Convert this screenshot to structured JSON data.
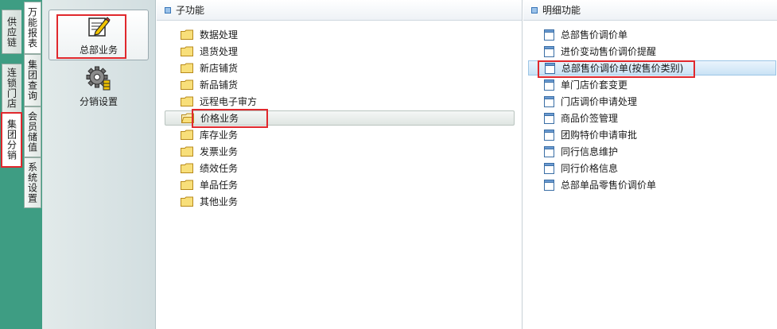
{
  "outer_tabs": [
    {
      "label": "供应链"
    },
    {
      "label": "连锁门店"
    },
    {
      "label": "集团分销",
      "active": true
    }
  ],
  "inner_tabs": [
    {
      "label": "万能报表"
    },
    {
      "label": "集团查询"
    },
    {
      "label": "会员储值"
    },
    {
      "label": "系统设置"
    }
  ],
  "modules": [
    {
      "label": "总部业务",
      "icon": "pen-on-doc-icon",
      "selected": true
    },
    {
      "label": "分销设置",
      "icon": "gear-icon"
    }
  ],
  "sub_panel": {
    "title": "子功能",
    "items": [
      {
        "label": "数据处理"
      },
      {
        "label": "退货处理"
      },
      {
        "label": "新店铺货"
      },
      {
        "label": "新品铺货"
      },
      {
        "label": "远程电子审方"
      },
      {
        "label": "价格业务",
        "selected": true
      },
      {
        "label": "库存业务"
      },
      {
        "label": "发票业务"
      },
      {
        "label": "绩效任务"
      },
      {
        "label": "单品任务"
      },
      {
        "label": "其他业务"
      }
    ]
  },
  "detail_panel": {
    "title": "明细功能",
    "items": [
      {
        "label": "总部售价调价单"
      },
      {
        "label": "进价变动售价调价提醒"
      },
      {
        "label": "总部售价调价单(按售价类别)",
        "selected": true
      },
      {
        "label": "单门店价套变更"
      },
      {
        "label": "门店调价申请处理"
      },
      {
        "label": "商品价签管理"
      },
      {
        "label": "团购特价申请审批"
      },
      {
        "label": "同行信息维护"
      },
      {
        "label": "同行价格信息"
      },
      {
        "label": "总部单品零售价调价单"
      }
    ]
  },
  "colors": {
    "strip_green": "#3e9d83",
    "highlight_red": "#e0282d",
    "selection_blue": "#c9e2f5"
  }
}
